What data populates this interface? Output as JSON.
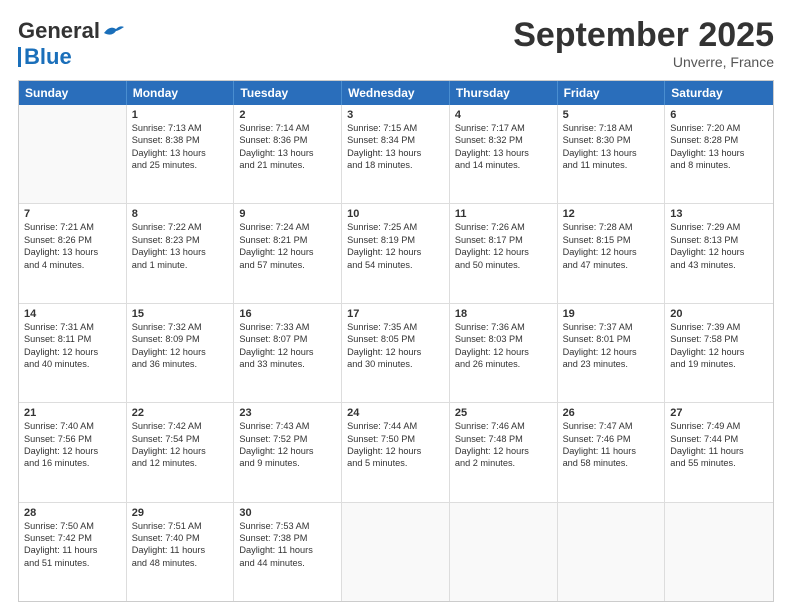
{
  "logo": {
    "line1": "General",
    "line2": "Blue"
  },
  "header": {
    "title": "September 2025",
    "location": "Unverre, France"
  },
  "days": [
    "Sunday",
    "Monday",
    "Tuesday",
    "Wednesday",
    "Thursday",
    "Friday",
    "Saturday"
  ],
  "rows": [
    [
      {
        "day": "",
        "lines": []
      },
      {
        "day": "1",
        "lines": [
          "Sunrise: 7:13 AM",
          "Sunset: 8:38 PM",
          "Daylight: 13 hours",
          "and 25 minutes."
        ]
      },
      {
        "day": "2",
        "lines": [
          "Sunrise: 7:14 AM",
          "Sunset: 8:36 PM",
          "Daylight: 13 hours",
          "and 21 minutes."
        ]
      },
      {
        "day": "3",
        "lines": [
          "Sunrise: 7:15 AM",
          "Sunset: 8:34 PM",
          "Daylight: 13 hours",
          "and 18 minutes."
        ]
      },
      {
        "day": "4",
        "lines": [
          "Sunrise: 7:17 AM",
          "Sunset: 8:32 PM",
          "Daylight: 13 hours",
          "and 14 minutes."
        ]
      },
      {
        "day": "5",
        "lines": [
          "Sunrise: 7:18 AM",
          "Sunset: 8:30 PM",
          "Daylight: 13 hours",
          "and 11 minutes."
        ]
      },
      {
        "day": "6",
        "lines": [
          "Sunrise: 7:20 AM",
          "Sunset: 8:28 PM",
          "Daylight: 13 hours",
          "and 8 minutes."
        ]
      }
    ],
    [
      {
        "day": "7",
        "lines": [
          "Sunrise: 7:21 AM",
          "Sunset: 8:26 PM",
          "Daylight: 13 hours",
          "and 4 minutes."
        ]
      },
      {
        "day": "8",
        "lines": [
          "Sunrise: 7:22 AM",
          "Sunset: 8:23 PM",
          "Daylight: 13 hours",
          "and 1 minute."
        ]
      },
      {
        "day": "9",
        "lines": [
          "Sunrise: 7:24 AM",
          "Sunset: 8:21 PM",
          "Daylight: 12 hours",
          "and 57 minutes."
        ]
      },
      {
        "day": "10",
        "lines": [
          "Sunrise: 7:25 AM",
          "Sunset: 8:19 PM",
          "Daylight: 12 hours",
          "and 54 minutes."
        ]
      },
      {
        "day": "11",
        "lines": [
          "Sunrise: 7:26 AM",
          "Sunset: 8:17 PM",
          "Daylight: 12 hours",
          "and 50 minutes."
        ]
      },
      {
        "day": "12",
        "lines": [
          "Sunrise: 7:28 AM",
          "Sunset: 8:15 PM",
          "Daylight: 12 hours",
          "and 47 minutes."
        ]
      },
      {
        "day": "13",
        "lines": [
          "Sunrise: 7:29 AM",
          "Sunset: 8:13 PM",
          "Daylight: 12 hours",
          "and 43 minutes."
        ]
      }
    ],
    [
      {
        "day": "14",
        "lines": [
          "Sunrise: 7:31 AM",
          "Sunset: 8:11 PM",
          "Daylight: 12 hours",
          "and 40 minutes."
        ]
      },
      {
        "day": "15",
        "lines": [
          "Sunrise: 7:32 AM",
          "Sunset: 8:09 PM",
          "Daylight: 12 hours",
          "and 36 minutes."
        ]
      },
      {
        "day": "16",
        "lines": [
          "Sunrise: 7:33 AM",
          "Sunset: 8:07 PM",
          "Daylight: 12 hours",
          "and 33 minutes."
        ]
      },
      {
        "day": "17",
        "lines": [
          "Sunrise: 7:35 AM",
          "Sunset: 8:05 PM",
          "Daylight: 12 hours",
          "and 30 minutes."
        ]
      },
      {
        "day": "18",
        "lines": [
          "Sunrise: 7:36 AM",
          "Sunset: 8:03 PM",
          "Daylight: 12 hours",
          "and 26 minutes."
        ]
      },
      {
        "day": "19",
        "lines": [
          "Sunrise: 7:37 AM",
          "Sunset: 8:01 PM",
          "Daylight: 12 hours",
          "and 23 minutes."
        ]
      },
      {
        "day": "20",
        "lines": [
          "Sunrise: 7:39 AM",
          "Sunset: 7:58 PM",
          "Daylight: 12 hours",
          "and 19 minutes."
        ]
      }
    ],
    [
      {
        "day": "21",
        "lines": [
          "Sunrise: 7:40 AM",
          "Sunset: 7:56 PM",
          "Daylight: 12 hours",
          "and 16 minutes."
        ]
      },
      {
        "day": "22",
        "lines": [
          "Sunrise: 7:42 AM",
          "Sunset: 7:54 PM",
          "Daylight: 12 hours",
          "and 12 minutes."
        ]
      },
      {
        "day": "23",
        "lines": [
          "Sunrise: 7:43 AM",
          "Sunset: 7:52 PM",
          "Daylight: 12 hours",
          "and 9 minutes."
        ]
      },
      {
        "day": "24",
        "lines": [
          "Sunrise: 7:44 AM",
          "Sunset: 7:50 PM",
          "Daylight: 12 hours",
          "and 5 minutes."
        ]
      },
      {
        "day": "25",
        "lines": [
          "Sunrise: 7:46 AM",
          "Sunset: 7:48 PM",
          "Daylight: 12 hours",
          "and 2 minutes."
        ]
      },
      {
        "day": "26",
        "lines": [
          "Sunrise: 7:47 AM",
          "Sunset: 7:46 PM",
          "Daylight: 11 hours",
          "and 58 minutes."
        ]
      },
      {
        "day": "27",
        "lines": [
          "Sunrise: 7:49 AM",
          "Sunset: 7:44 PM",
          "Daylight: 11 hours",
          "and 55 minutes."
        ]
      }
    ],
    [
      {
        "day": "28",
        "lines": [
          "Sunrise: 7:50 AM",
          "Sunset: 7:42 PM",
          "Daylight: 11 hours",
          "and 51 minutes."
        ]
      },
      {
        "day": "29",
        "lines": [
          "Sunrise: 7:51 AM",
          "Sunset: 7:40 PM",
          "Daylight: 11 hours",
          "and 48 minutes."
        ]
      },
      {
        "day": "30",
        "lines": [
          "Sunrise: 7:53 AM",
          "Sunset: 7:38 PM",
          "Daylight: 11 hours",
          "and 44 minutes."
        ]
      },
      {
        "day": "",
        "lines": []
      },
      {
        "day": "",
        "lines": []
      },
      {
        "day": "",
        "lines": []
      },
      {
        "day": "",
        "lines": []
      }
    ]
  ]
}
